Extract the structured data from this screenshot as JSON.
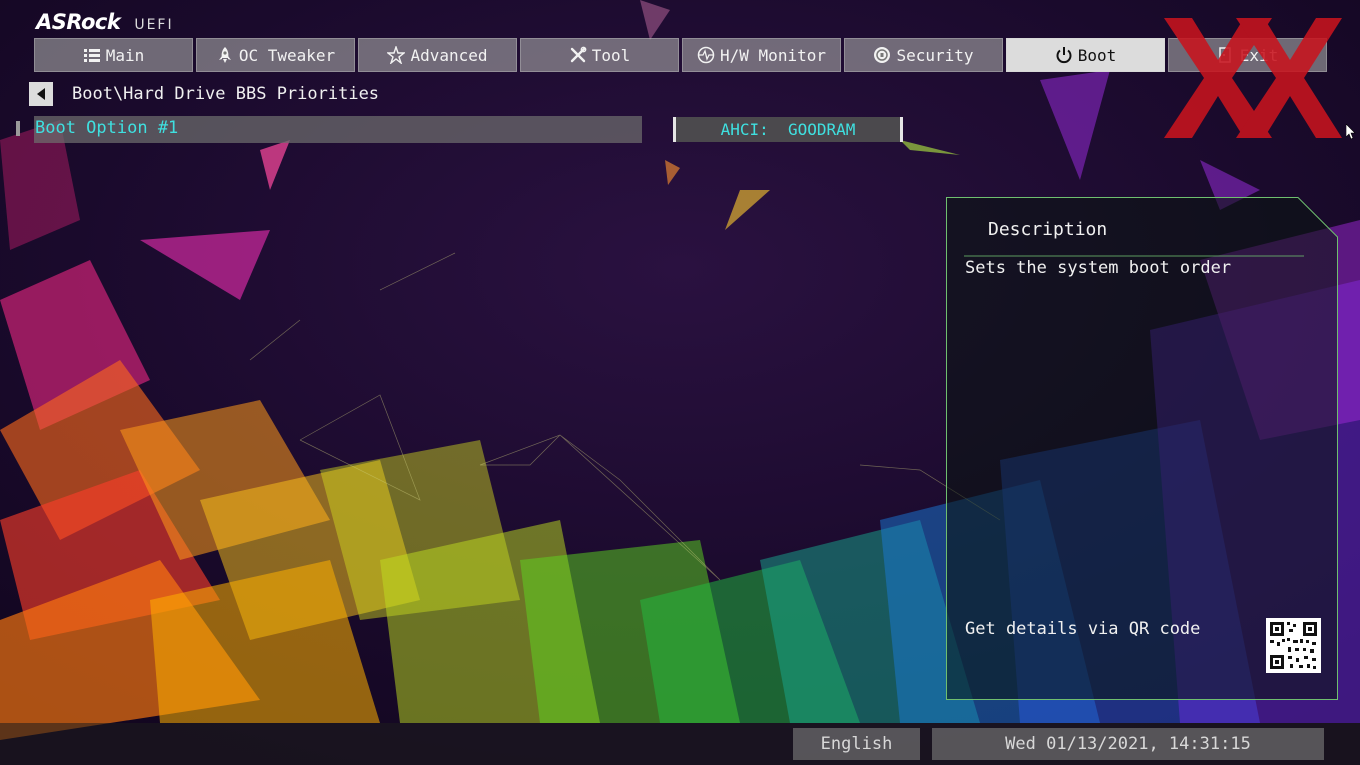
{
  "logo": {
    "brand": "ASRock",
    "sub": "UEFI"
  },
  "tabs": [
    {
      "label": "Main",
      "icon": "list-icon"
    },
    {
      "label": "OC Tweaker",
      "icon": "rocket-icon"
    },
    {
      "label": "Advanced",
      "icon": "star-icon"
    },
    {
      "label": "Tool",
      "icon": "tools-icon"
    },
    {
      "label": "H/W Monitor",
      "icon": "monitor-icon"
    },
    {
      "label": "Security",
      "icon": "shield-icon"
    },
    {
      "label": "Boot",
      "icon": "power-icon",
      "active": true
    },
    {
      "label": "Exit",
      "icon": "exit-icon"
    }
  ],
  "breadcrumb": {
    "path": "Boot\\Hard Drive BBS Priorities"
  },
  "boot_option": {
    "label": "Boot Option #1",
    "value": "AHCI:  GOODRAM"
  },
  "description": {
    "title": "Description",
    "text": "Sets the system boot order",
    "qr_prompt": "Get details via QR code"
  },
  "footer": {
    "language": "English",
    "datetime": "Wed 01/13/2021, 14:31:15"
  },
  "colors": {
    "accent_cyan": "#3fe0e0",
    "panel_border": "#6fbf6f",
    "active_tab": "#dcdcdc",
    "watermark_red": "#c8141e"
  }
}
